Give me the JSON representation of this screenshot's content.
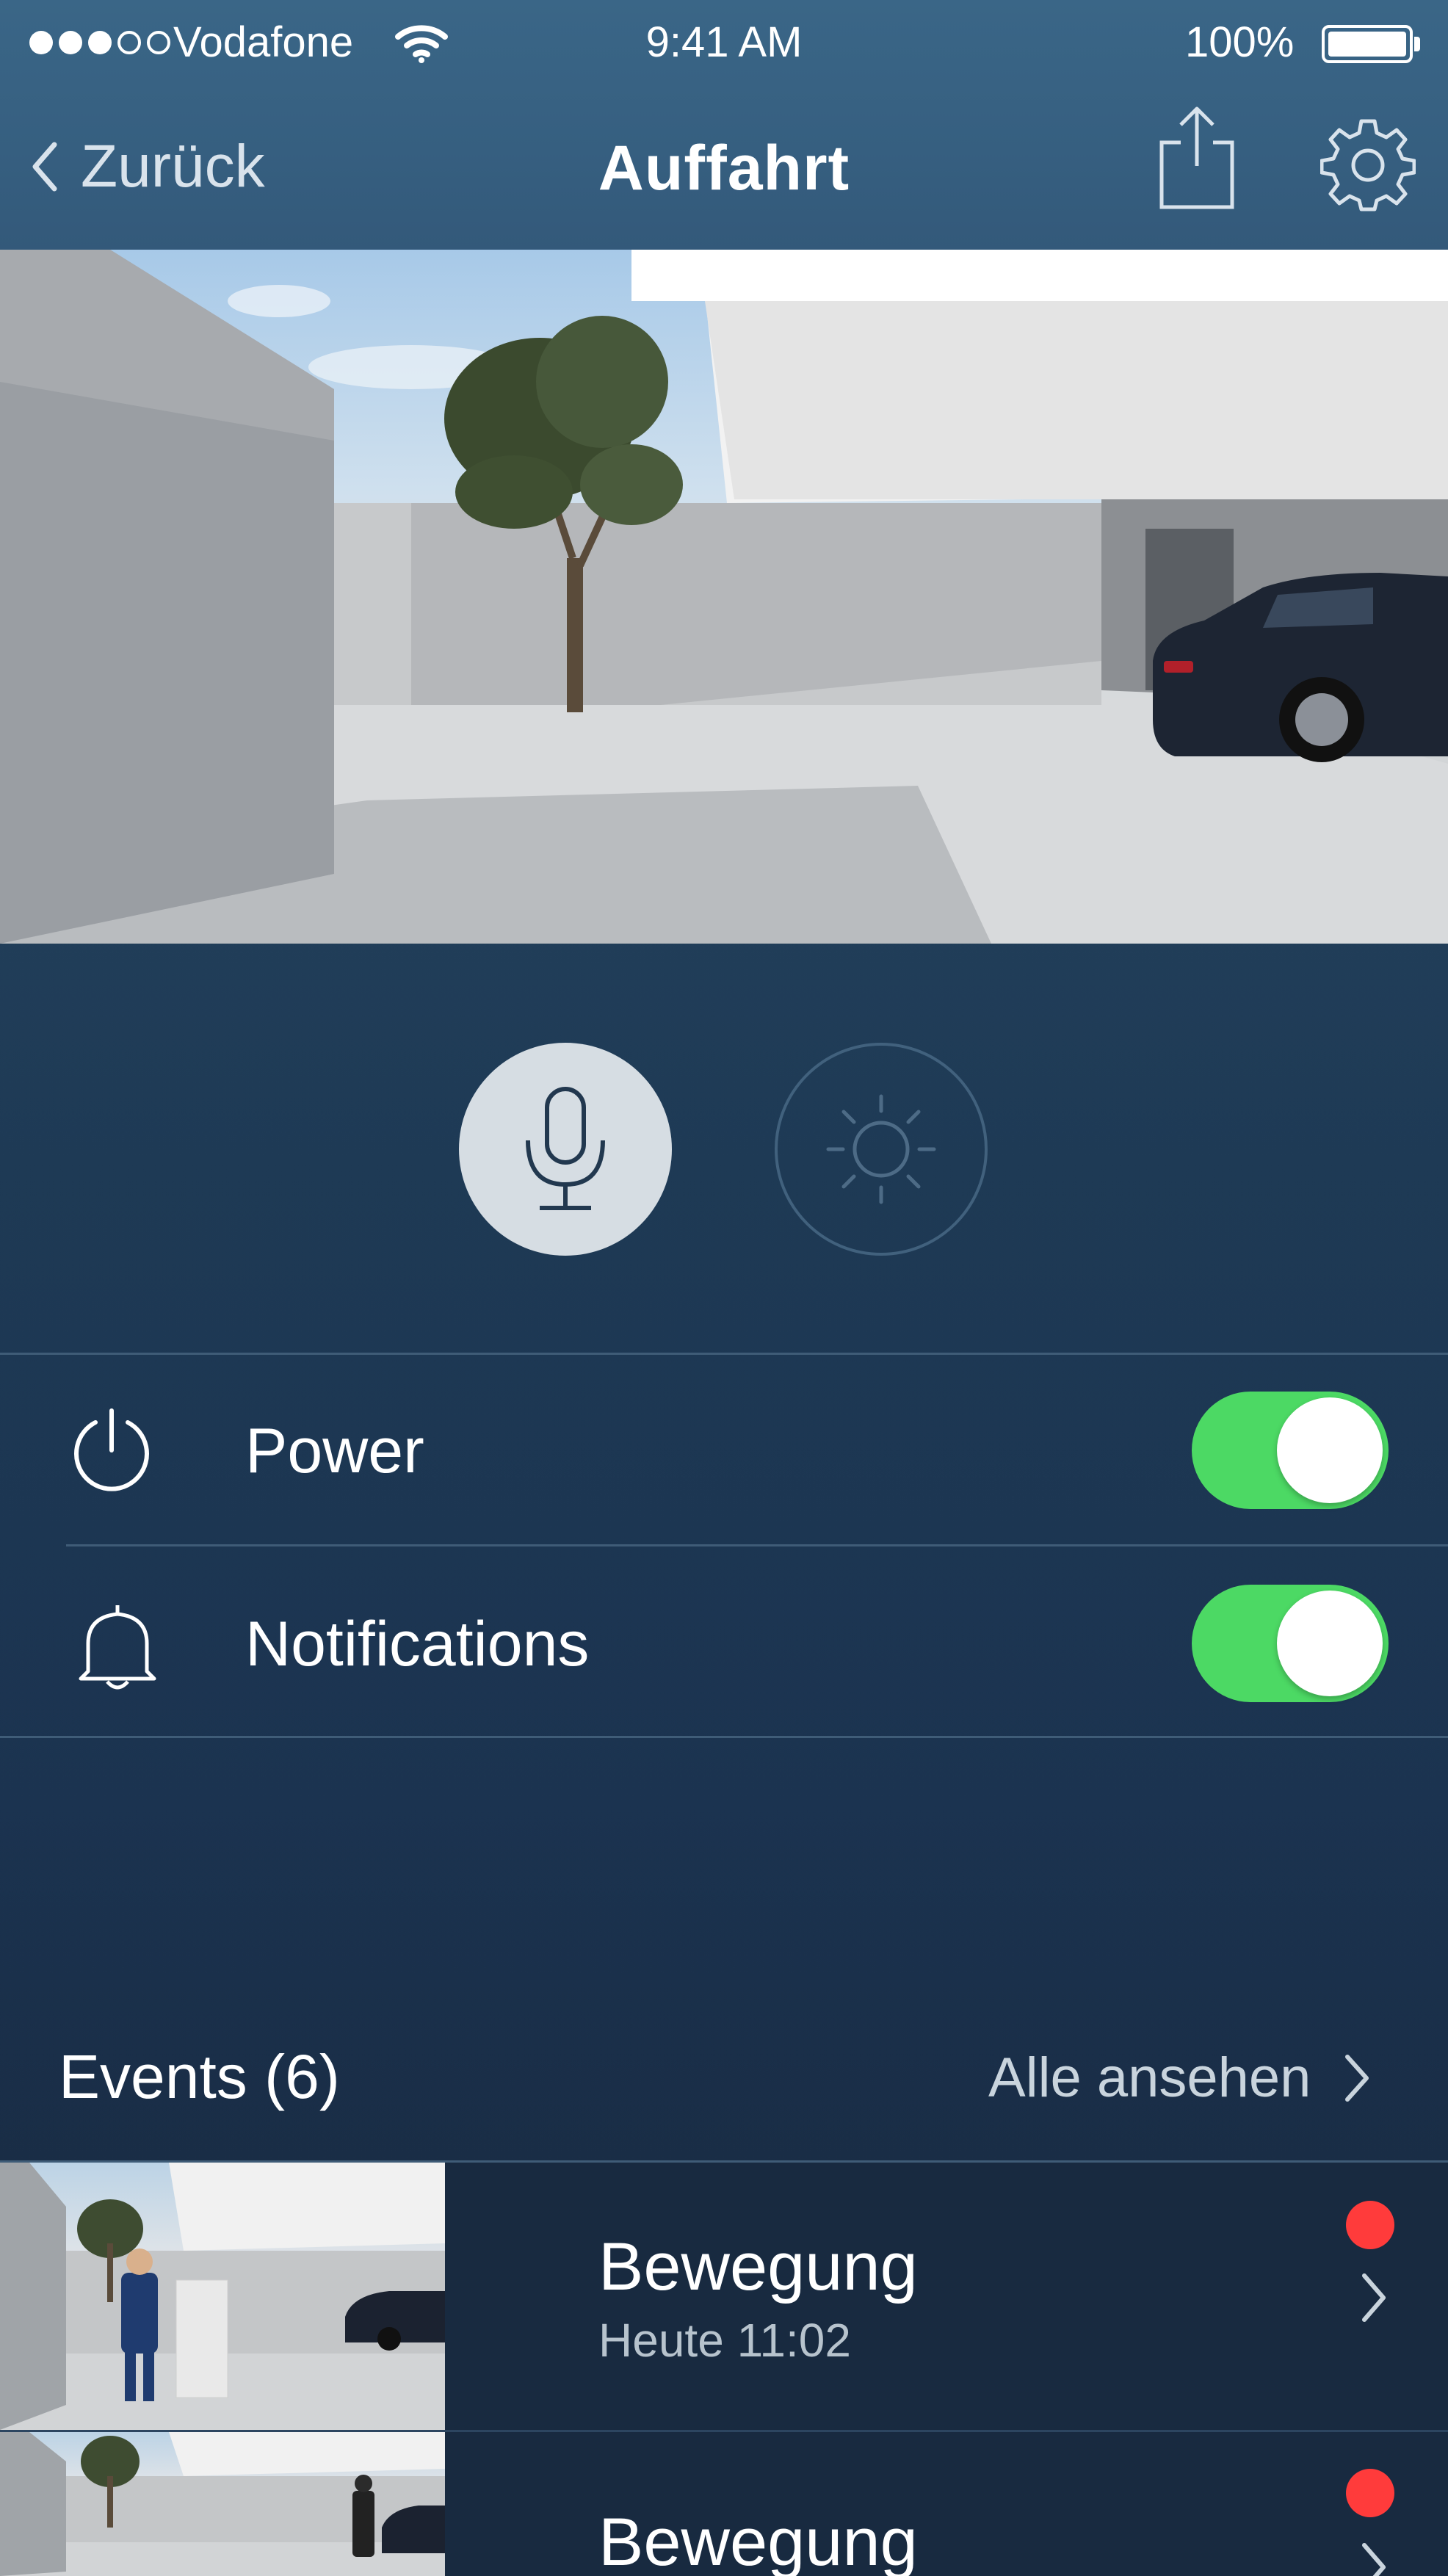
{
  "status_bar": {
    "signal_bars_filled": 3,
    "signal_bars_total": 5,
    "carrier": "Vodafone",
    "time": "9:41 AM",
    "battery": "100%"
  },
  "nav": {
    "back_label": "Zurück",
    "title": "Auffahrt"
  },
  "controls": {
    "microphone_active": true,
    "light_active": false
  },
  "settings": [
    {
      "label": "Power",
      "enabled": true
    },
    {
      "label": "Notifications",
      "enabled": true
    }
  ],
  "events": {
    "title": "Events (6)",
    "see_all_label": "Alle ansehen",
    "items": [
      {
        "title": "Bewegung",
        "time": "Heute 11:02",
        "unread": true
      },
      {
        "title": "Bewegung",
        "time": "",
        "unread": true
      }
    ]
  },
  "colors": {
    "toggle_on": "#4cd964",
    "unread_dot": "#ff3b3b",
    "header": "#365f80"
  }
}
